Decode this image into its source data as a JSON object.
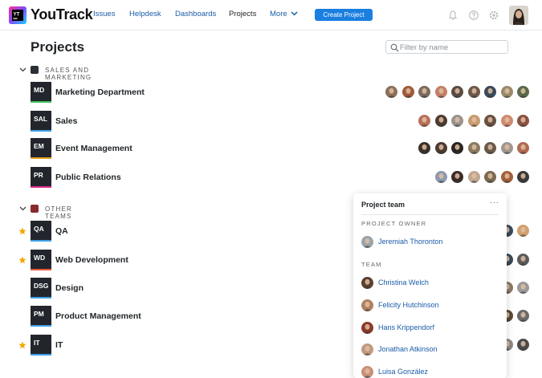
{
  "app": {
    "name": "YouTrack",
    "nav": [
      "Issues",
      "Helpdesk",
      "Dashboards",
      "Projects"
    ],
    "more_label": "More",
    "create_label": "Create Project"
  },
  "page": {
    "title": "Projects",
    "filter_placeholder": "Filter by name"
  },
  "groups": [
    {
      "label": "SALES AND MARKETING",
      "projects": [
        {
          "abbr": "MD",
          "name": "Marketing Department",
          "color": "#3fbf5c",
          "starred": false,
          "avatars": [
            "#8a6f5a",
            "#a05a3c",
            "#7c6a5e",
            "#c48066",
            "#5a4c44",
            "#6e5848",
            "#3a4a5a",
            "#9a8a6c",
            "#5a6a4a"
          ]
        },
        {
          "abbr": "SAL",
          "name": "Sales",
          "color": "#3fa0e8",
          "starred": false,
          "avatars": [
            "#b8705a",
            "#4a3a32",
            "#9a9490",
            "#c89a70",
            "#6a5040",
            "#d08a70",
            "#8a5040"
          ]
        },
        {
          "abbr": "EM",
          "name": "Event Management",
          "color": "#e8a020",
          "starred": false,
          "avatars": [
            "#3a3028",
            "#4a3a30",
            "#2a2420",
            "#8a7a60",
            "#6a5a4a",
            "#a09890",
            "#b06a50"
          ]
        },
        {
          "abbr": "PR",
          "name": "Public Relations",
          "color": "#e02a8a",
          "starred": false,
          "avatars": [
            "#8a9ab0",
            "#3a2a28",
            "#c0a890",
            "#7a6a50",
            "#a0603a",
            "#3a3a3a"
          ]
        }
      ]
    },
    {
      "label": "OTHER TEAMS",
      "projects": [
        {
          "abbr": "QA",
          "name": "QA",
          "color": "#3fa0e8",
          "starred": true,
          "avatars": [
            "#3a4a5a",
            "#d0a070"
          ]
        },
        {
          "abbr": "WD",
          "name": "Web Development",
          "color": "#e85a3a",
          "starred": true,
          "avatars": [
            "#3a4a5a",
            "#5a5a5a"
          ]
        },
        {
          "abbr": "DSG",
          "name": "Design",
          "color": "#3fa0e8",
          "starred": false,
          "avatars": [
            "#8a7a6a",
            "#9a9a9a"
          ]
        },
        {
          "abbr": "PM",
          "name": "Product Management",
          "color": "#3fa0e8",
          "starred": false,
          "avatars": [
            "#5a4a3a",
            "#6a6a6a"
          ]
        },
        {
          "abbr": "IT",
          "name": "IT",
          "color": "#3fa0e8",
          "starred": true,
          "avatars": [
            "#8a8a8a",
            "#4a4a4a"
          ]
        }
      ]
    }
  ],
  "popup": {
    "title": "Project team",
    "more": "···",
    "owner_label": "PROJECT OWNER",
    "owner": {
      "name": "Jeremiah Thoronton",
      "avatar": "#9aa2aa"
    },
    "team_label": "TEAM",
    "team": [
      {
        "name": "Christina Welch",
        "avatar": "#5a4030"
      },
      {
        "name": "Felicity Hutchinson",
        "avatar": "#b08060"
      },
      {
        "name": "Hans Krippendorf",
        "avatar": "#8a3a2a"
      },
      {
        "name": "Jonathan Atkinson",
        "avatar": "#c09a80"
      },
      {
        "name": "Luisa González",
        "avatar": "#c89078"
      }
    ]
  },
  "colors": {
    "accent": "#1a7fe0",
    "link": "#1a5ca8",
    "star": "#f0a800"
  }
}
